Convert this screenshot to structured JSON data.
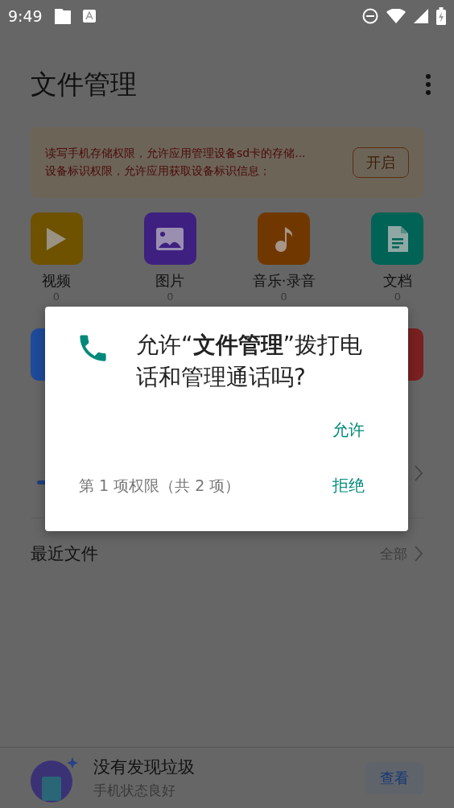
{
  "status_bar": {
    "time": "9:49"
  },
  "app_bar": {
    "title": "文件管理"
  },
  "permission_banner": {
    "lines": [
      "读写手机存储权限，允许应用管理设备sd卡的存储...",
      "设备标识权限，允许应用获取设备标识信息；"
    ],
    "button": "开启"
  },
  "categories": [
    {
      "kind": "video",
      "label": "视频",
      "count": "0",
      "color": "#6e5200"
    },
    {
      "kind": "image",
      "label": "图片",
      "count": "0",
      "color": "#3e2080"
    },
    {
      "kind": "music",
      "label": "音乐·录音",
      "count": "0",
      "color": "#703800"
    },
    {
      "kind": "document",
      "label": "文档",
      "count": "0",
      "color": "#006356"
    }
  ],
  "categories_row_2": [
    {
      "color": "#1e4a9a"
    },
    {
      "color": "#7a2020"
    }
  ],
  "recent_files": {
    "title": "最近文件",
    "link": "全部"
  },
  "cleanup": {
    "title": "没有发现垃圾",
    "subtitle": "手机状态良好",
    "button": "查看"
  },
  "dialog": {
    "message": "允许“**文件管理**”拨打电话和管理通话吗?",
    "allow": "允许",
    "step": "第 1 项权限（共 2 项）",
    "deny": "拒绝"
  }
}
